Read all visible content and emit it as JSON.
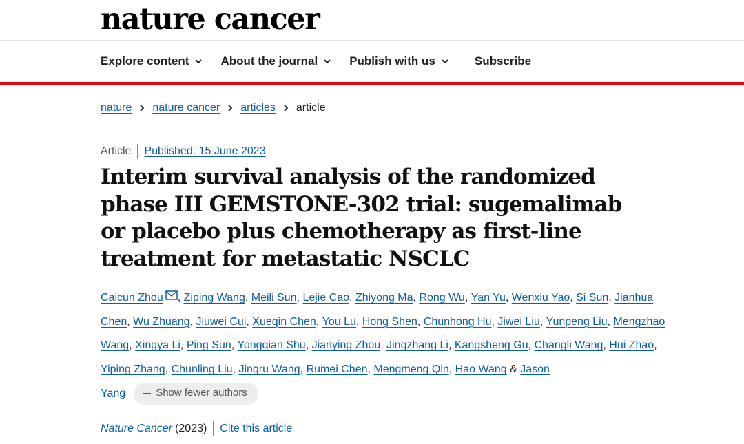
{
  "site": {
    "logo": "nature cancer"
  },
  "nav": {
    "items": [
      {
        "label": "Explore content"
      },
      {
        "label": "About the journal"
      },
      {
        "label": "Publish with us"
      }
    ],
    "subscribe": "Subscribe"
  },
  "breadcrumb": [
    "nature",
    "nature cancer",
    "articles",
    "article"
  ],
  "article": {
    "type": "Article",
    "published": "Published: 15 June 2023",
    "title": "Interim survival analysis of the randomized phase III GEMSTONE-302 trial: sugemalimab or placebo plus chemotherapy as first-line treatment for metastatic NSCLC",
    "authors": [
      "Caicun Zhou",
      "Ziping Wang",
      "Meili Sun",
      "Lejie Cao",
      "Zhiyong Ma",
      "Rong Wu",
      "Yan Yu",
      "Wenxiu Yao",
      "Si Sun",
      "Jianhua Chen",
      "Wu Zhuang",
      "Jiuwei Cui",
      "Xueqin Chen",
      "You Lu",
      "Hong Shen",
      "Chunhong Hu",
      "Jiwei Liu",
      "Yunpeng Liu",
      "Mengzhao Wang",
      "Xingya Li",
      "Ping Sun",
      "Yongqian Shu",
      "Jianying Zhou",
      "Jingzhang Li",
      "Kangsheng Gu",
      "Changli Wang",
      "Hui Zhao",
      "Yiping Zhang",
      "Chunling Liu",
      "Jingru Wang",
      "Rumei Chen",
      "Mengmeng Qin",
      "Hao Wang",
      "Jason Yang"
    ],
    "show_fewer_label": "Show fewer authors",
    "journal": "Nature Cancer",
    "year": "(2023)",
    "cite_label": "Cite this article"
  },
  "icons": {
    "nav_chevron": "chevron-down-icon",
    "crumb_separator": "chevron-right-icon",
    "corresponding": "mail-icon",
    "collapse": "minus-icon"
  },
  "colors": {
    "link": "#0c5fa6",
    "accent_bar": "#e30613",
    "text": "#222222"
  }
}
